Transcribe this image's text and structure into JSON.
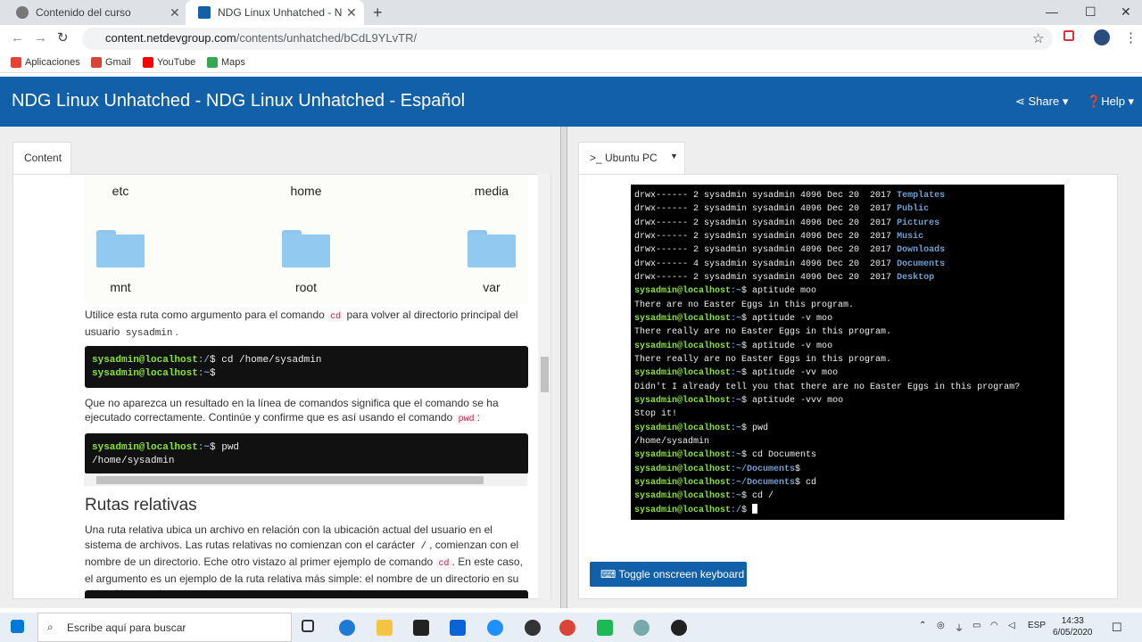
{
  "browser": {
    "tabs": [
      {
        "label": "Contenido del curso"
      },
      {
        "label": "NDG Linux Unhatched - NDG Lin"
      }
    ],
    "url_host": "content.netdevgroup.com",
    "url_path": "/contents/unhatched/bCdL9YLvTR/",
    "bookmarks": [
      "Aplicaciones",
      "Gmail",
      "YouTube",
      "Maps"
    ]
  },
  "header": {
    "title": "NDG Linux Unhatched - NDG Linux Unhatched - Español",
    "share": "Share",
    "help": "Help"
  },
  "left": {
    "tab": "Content",
    "folders": [
      "etc",
      "home",
      "media",
      "mnt",
      "root",
      "var"
    ],
    "p1_a": "Utilice esta ruta como argumento para el comando ",
    "p1_code": "cd",
    "p1_b": " para volver al directorio principal del usuario ",
    "p1_code2": "sysadmin",
    "p1_c": ".",
    "code1": {
      "prompt1": "sysadmin@localhost",
      "path1": ":/",
      "cmd1": "$ cd /home/sysadmin",
      "prompt2": "sysadmin@localhost",
      "path2": ":~",
      "cmd2": "$"
    },
    "p2_a": "Que no aparezca un resultado en la línea de comandos significa que el comando se ha ejecutado correctamente. Continúe y confirme que es así usando el comando ",
    "p2_code": "pwd",
    "p2_b": ":",
    "code2": {
      "prompt1": "sysadmin@localhost",
      "path1": ":~",
      "cmd1": "$ pwd",
      "out1": "/home/sysadmin"
    },
    "h2": "Rutas relativas",
    "p3_a": "Una ruta relativa ubica un archivo en relación con la ubicación actual del usuario en el sistema de archivos. Las rutas relativas no comienzan con el carácter ",
    "p3_code": "/",
    "p3_b": ", comienzan con el nombre de un directorio. Eche otro vistazo al primer ejemplo de comando ",
    "p3_code2": "cd",
    "p3_c": ". En este caso, el argumento es un ejemplo de la ruta relativa más simple: el nombre de un directorio en su ubicación actual."
  },
  "right": {
    "tab": ">_ Ubuntu PC",
    "keyboard_button": "Toggle onscreen keyboard",
    "terminal": [
      {
        "t": "drwx------ 2 sysadmin sysadmin 4096 Dec 20  2017 ",
        "b": "Templates"
      },
      {
        "t": "drwx------ 2 sysadmin sysadmin 4096 Dec 20  2017 ",
        "b": "Public"
      },
      {
        "t": "drwx------ 2 sysadmin sysadmin 4096 Dec 20  2017 ",
        "b": "Pictures"
      },
      {
        "t": "drwx------ 2 sysadmin sysadmin 4096 Dec 20  2017 ",
        "b": "Music"
      },
      {
        "t": "drwx------ 2 sysadmin sysadmin 4096 Dec 20  2017 ",
        "b": "Downloads"
      },
      {
        "t": "drwx------ 4 sysadmin sysadmin 4096 Dec 20  2017 ",
        "b": "Documents"
      },
      {
        "t": "drwx------ 2 sysadmin sysadmin 4096 Dec 20  2017 ",
        "b": "Desktop"
      },
      {
        "p": "sysadmin@localhost",
        "c": ":~",
        "t": "$ aptitude moo"
      },
      {
        "t": "There are no Easter Eggs in this program."
      },
      {
        "p": "sysadmin@localhost",
        "c": ":~",
        "t": "$ aptitude -v moo"
      },
      {
        "t": "There really are no Easter Eggs in this program."
      },
      {
        "p": "sysadmin@localhost",
        "c": ":~",
        "t": "$ aptitude -v moo"
      },
      {
        "t": "There really are no Easter Eggs in this program."
      },
      {
        "p": "sysadmin@localhost",
        "c": ":~",
        "t": "$ aptitude -vv moo"
      },
      {
        "t": "Didn't I already tell you that there are no Easter Eggs in this program?"
      },
      {
        "p": "sysadmin@localhost",
        "c": ":~",
        "t": "$ aptitude -vvv moo"
      },
      {
        "t": "Stop it!"
      },
      {
        "p": "sysadmin@localhost",
        "c": ":~",
        "t": "$ pwd"
      },
      {
        "t": "/home/sysadmin"
      },
      {
        "p": "sysadmin@localhost",
        "c": ":~",
        "t": "$ cd Documents"
      },
      {
        "p": "sysadmin@localhost",
        "c": ":~/Documents",
        "t": "$"
      },
      {
        "p": "sysadmin@localhost",
        "c": ":~/Documents",
        "t": "$ cd"
      },
      {
        "p": "sysadmin@localhost",
        "c": ":~",
        "t": "$ cd /"
      },
      {
        "p": "sysadmin@localhost",
        "c": ":/",
        "t": "$ ",
        "cursor": true
      }
    ]
  },
  "taskbar": {
    "search_placeholder": "Escribe aquí para buscar",
    "lang": "ESP",
    "time": "14:33",
    "date": "6/05/2020"
  }
}
